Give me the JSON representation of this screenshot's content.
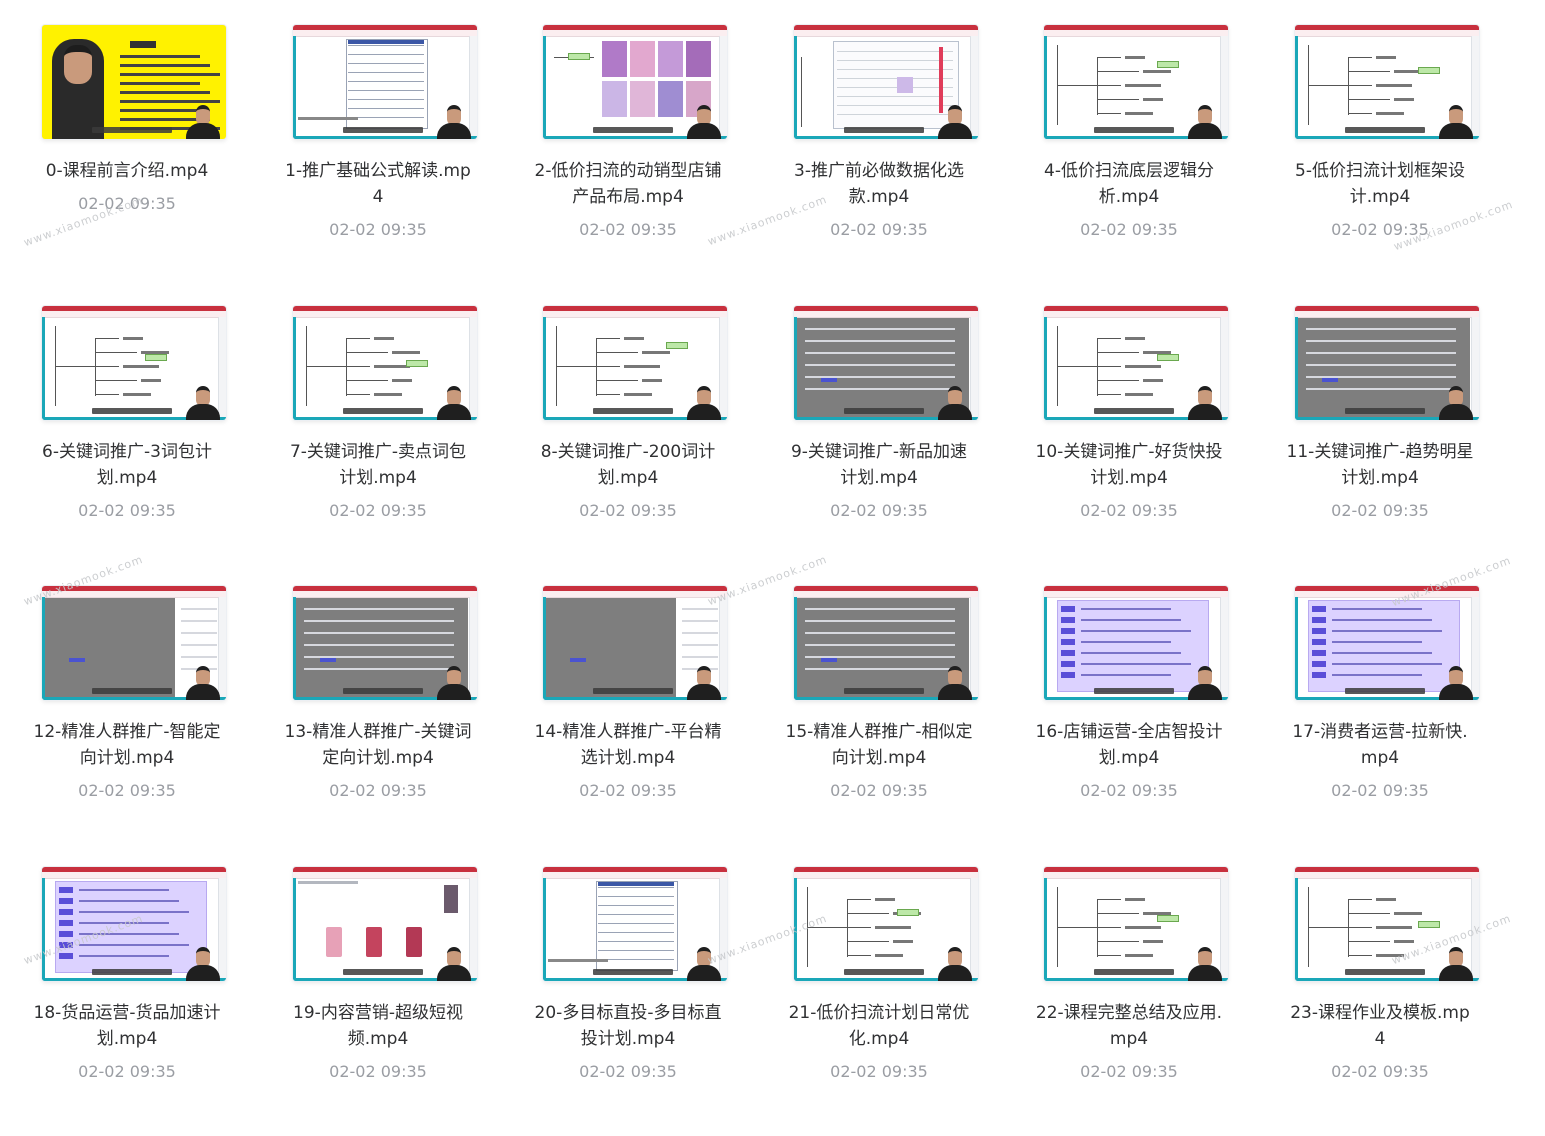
{
  "files": [
    {
      "name": "0-课程前言介绍.mp4",
      "time": "02-02 09:35",
      "style": "intro"
    },
    {
      "name": "1-推广基础公式解读.mp4",
      "time": "02-02 09:35",
      "style": "table"
    },
    {
      "name": "2-低价扫流的动销型店铺产品布局.mp4",
      "time": "02-02 09:35",
      "style": "products"
    },
    {
      "name": "3-推广前必做数据化选款.mp4",
      "time": "02-02 09:35",
      "style": "data"
    },
    {
      "name": "4-低价扫流底层逻辑分析.mp4",
      "time": "02-02 09:35",
      "style": "mindmap"
    },
    {
      "name": "5-低价扫流计划框架设计.mp4",
      "time": "02-02 09:35",
      "style": "mindmap"
    },
    {
      "name": "6-关键词推广-3词包计划.mp4",
      "time": "02-02 09:35",
      "style": "mindmap"
    },
    {
      "name": "7-关键词推广-卖点词包计划.mp4",
      "time": "02-02 09:35",
      "style": "mindmap"
    },
    {
      "name": "8-关键词推广-200词计划.mp4",
      "time": "02-02 09:35",
      "style": "mindmap"
    },
    {
      "name": "9-关键词推广-新品加速计划.mp4",
      "time": "02-02 09:35",
      "style": "gray"
    },
    {
      "name": "10-关键词推广-好货快投计划.mp4",
      "time": "02-02 09:35",
      "style": "mindmap"
    },
    {
      "name": "11-关键词推广-趋势明星计划.mp4",
      "time": "02-02 09:35",
      "style": "gray"
    },
    {
      "name": "12-精准人群推广-智能定向计划.mp4",
      "time": "02-02 09:35",
      "style": "gray"
    },
    {
      "name": "13-精准人群推广-关键词定向计划.mp4",
      "time": "02-02 09:35",
      "style": "gray"
    },
    {
      "name": "14-精准人群推广-平台精选计划.mp4",
      "time": "02-02 09:35",
      "style": "gray"
    },
    {
      "name": "15-精准人群推广-相似定向计划.mp4",
      "time": "02-02 09:35",
      "style": "gray"
    },
    {
      "name": "16-店铺运营-全店智投计划.mp4",
      "time": "02-02 09:35",
      "style": "purple"
    },
    {
      "name": "17-消费者运营-拉新快.mp4",
      "time": "02-02 09:35",
      "style": "purple"
    },
    {
      "name": "18-货品运营-货品加速计划.mp4",
      "time": "02-02 09:35",
      "style": "purple"
    },
    {
      "name": "19-内容营销-超级短视频.mp4",
      "time": "02-02 09:35",
      "style": "video"
    },
    {
      "name": "20-多目标直投-多目标直投计划.mp4",
      "time": "02-02 09:35",
      "style": "table"
    },
    {
      "name": "21-低价扫流计划日常优化.mp4",
      "time": "02-02 09:35",
      "style": "mindmap"
    },
    {
      "name": "22-课程完整总结及应用.mp4",
      "time": "02-02 09:35",
      "style": "mindmap"
    },
    {
      "name": "23-课程作业及模板.mp4",
      "time": "02-02 09:35",
      "style": "mindmap"
    }
  ],
  "watermark": "www.xiaomook.com",
  "colors": {
    "accent_red": "#c8303e",
    "teal": "#1aa7b8",
    "intro_yellow": "#fff200",
    "text": "#303133",
    "muted": "#9a9da3"
  }
}
